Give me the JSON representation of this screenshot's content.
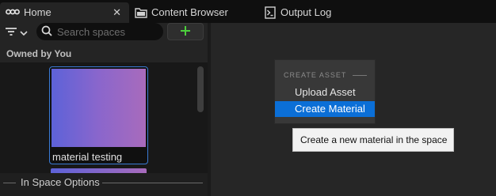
{
  "tabs": [
    {
      "label": "Home",
      "icon": "spaces-logo-icon",
      "active": true,
      "close": "✕"
    },
    {
      "label": "Content Browser",
      "icon": "folder-icon",
      "active": false
    },
    {
      "label": "Output Log",
      "icon": "terminal-icon",
      "active": false
    }
  ],
  "sidebar": {
    "search_placeholder": "Search spaces",
    "add_label": "+",
    "section_title": "Owned by You",
    "cards": [
      {
        "label": "material testing",
        "selected": true
      },
      {
        "label": "",
        "selected": false
      }
    ],
    "footer": "In Space Options"
  },
  "context_menu": {
    "header": "CREATE ASSET",
    "items": [
      {
        "label": "Upload Asset",
        "highlighted": false
      },
      {
        "label": "Create Material",
        "highlighted": true
      }
    ]
  },
  "tooltip": "Create a new material in the space",
  "colors": {
    "accent": "#0b6fd7",
    "add_button_icon": "#4cd03c",
    "card_gradient_start": "#5d62d8",
    "card_gradient_end": "#a86bbc"
  }
}
